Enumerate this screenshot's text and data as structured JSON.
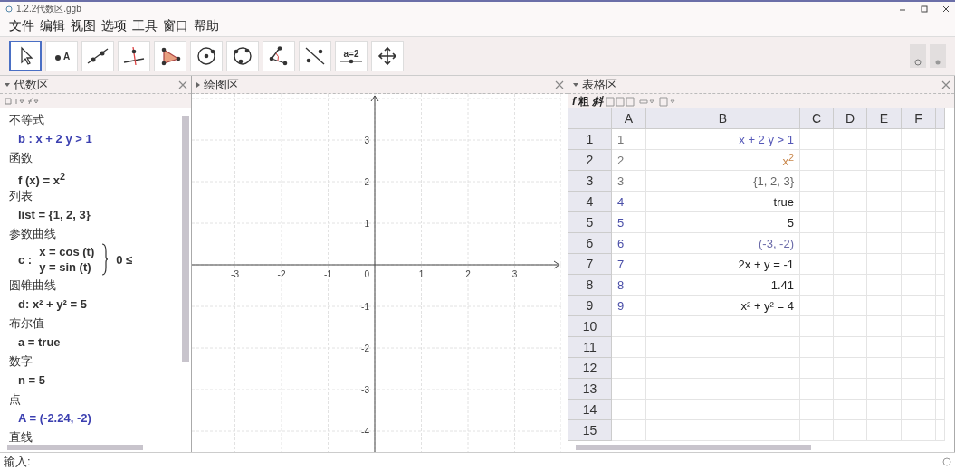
{
  "window": {
    "title": "1.2.2代数区.ggb"
  },
  "menu": [
    "文件",
    "编辑",
    "视图",
    "选项",
    "工具",
    "窗口",
    "帮助"
  ],
  "tools": [
    {
      "kind": "move",
      "selected": true
    },
    {
      "kind": "point",
      "selected": false,
      "label": "A"
    },
    {
      "kind": "line",
      "selected": false
    },
    {
      "kind": "perpendicular",
      "selected": false
    },
    {
      "kind": "polygon",
      "selected": false
    },
    {
      "kind": "circle",
      "selected": false
    },
    {
      "kind": "circle3",
      "selected": false
    },
    {
      "kind": "angle",
      "selected": false
    },
    {
      "kind": "reflect",
      "selected": false
    },
    {
      "kind": "slider",
      "selected": false,
      "label": "a=2"
    },
    {
      "kind": "pan",
      "selected": false
    }
  ],
  "algebra": {
    "title": "代数区",
    "groups": [
      {
        "label": "不等式",
        "items": [
          {
            "kind": "plain",
            "text": "b : x + 2 y > 1",
            "color": "#3b3fb0"
          }
        ]
      },
      {
        "label": "函数",
        "items": [
          {
            "kind": "plain",
            "text": "f (x)  =  x$^{2}$",
            "color": "#333333"
          }
        ]
      },
      {
        "label": "列表",
        "items": [
          {
            "kind": "plain",
            "text": "list = {1, 2, 3}",
            "color": "#333333"
          }
        ]
      },
      {
        "label": "参数曲线",
        "items": [
          {
            "kind": "parametric",
            "name": "c :",
            "lines": [
              "x = cos (t)",
              "y = sin (t)"
            ],
            "suffix": "0 ≤",
            "color": "#333333"
          }
        ]
      },
      {
        "label": "圆锥曲线",
        "items": [
          {
            "kind": "plain",
            "text": "d: x² + y² = 5",
            "color": "#333333"
          }
        ]
      },
      {
        "label": "布尔值",
        "items": [
          {
            "kind": "plain",
            "text": "a = true",
            "color": "#333333"
          }
        ]
      },
      {
        "label": "数字",
        "items": [
          {
            "kind": "plain",
            "text": "n = 5",
            "color": "#333333"
          }
        ]
      },
      {
        "label": "点",
        "items": [
          {
            "kind": "plain",
            "text": "A = (-2.24, -2)",
            "color": "#3b3fb0"
          }
        ]
      },
      {
        "label": "直线"
      }
    ]
  },
  "graphics": {
    "title": "绘图区",
    "x_ticks": [
      "-3",
      "-2",
      "-1",
      "1",
      "2",
      "3"
    ],
    "y_ticks": [
      "3",
      "2",
      "1",
      "-1",
      "-2",
      "-3",
      "-4"
    ],
    "origin": "0"
  },
  "spreadsheet": {
    "title": "表格区",
    "toolbar": [
      "f",
      "粗",
      "斜"
    ],
    "columns": [
      "A",
      "B",
      "C",
      "D",
      "E",
      "F"
    ],
    "rows": [
      {
        "label": "1",
        "a": {
          "text": "1",
          "color": "#777777"
        },
        "b": {
          "text": "x + 2 y > 1",
          "color": "#5558b8"
        }
      },
      {
        "label": "2",
        "a": {
          "text": "2",
          "color": "#777777"
        },
        "b": {
          "text": "x$^{2}$",
          "color": "#c8864a"
        }
      },
      {
        "label": "3",
        "a": {
          "text": "3",
          "color": "#777777"
        },
        "b": {
          "text": "{1, 2, 3}",
          "color": "#666666"
        }
      },
      {
        "label": "4",
        "a": {
          "text": "4",
          "color": "#4a4fa8"
        },
        "b": {
          "text": "true",
          "color": "#222222"
        }
      },
      {
        "label": "5",
        "a": {
          "text": "5",
          "color": "#4a4fa8"
        },
        "b": {
          "text": "5",
          "color": "#222222"
        }
      },
      {
        "label": "6",
        "a": {
          "text": "6",
          "color": "#4a4fa8"
        },
        "b": {
          "text": "(-3, -2)",
          "color": "#6a6aa8"
        }
      },
      {
        "label": "7",
        "a": {
          "text": "7",
          "color": "#4a4fa8"
        },
        "b": {
          "text": "2x + y = -1",
          "color": "#222222"
        }
      },
      {
        "label": "8",
        "a": {
          "text": "8",
          "color": "#4a4fa8"
        },
        "b": {
          "text": "1.41",
          "color": "#222222"
        }
      },
      {
        "label": "9",
        "a": {
          "text": "9",
          "color": "#4a4fa8"
        },
        "b": {
          "text": "x² + y² = 4",
          "color": "#222222"
        }
      },
      {
        "label": "10"
      },
      {
        "label": "11"
      },
      {
        "label": "12"
      },
      {
        "label": "13"
      },
      {
        "label": "14"
      },
      {
        "label": "15"
      }
    ]
  },
  "input": {
    "label": "输入:"
  }
}
